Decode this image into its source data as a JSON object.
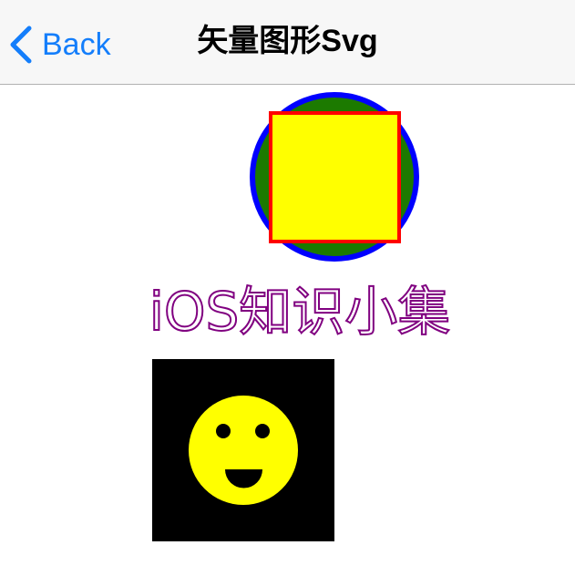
{
  "nav": {
    "back_label": "Back",
    "title": "矢量图形Svg"
  },
  "svg_demo": {
    "outline_text": "iOS知识小集",
    "colors": {
      "circle_fill": "#1c7a00",
      "circle_stroke": "#0000ff",
      "square_fill": "#ffff00",
      "square_stroke": "#ff0000",
      "outline_text_stroke": "#800080",
      "smiley_background": "#000000",
      "smiley_face": "#ffff00",
      "smiley_features": "#000000"
    }
  },
  "icons": {
    "back": "chevron-left-icon"
  }
}
